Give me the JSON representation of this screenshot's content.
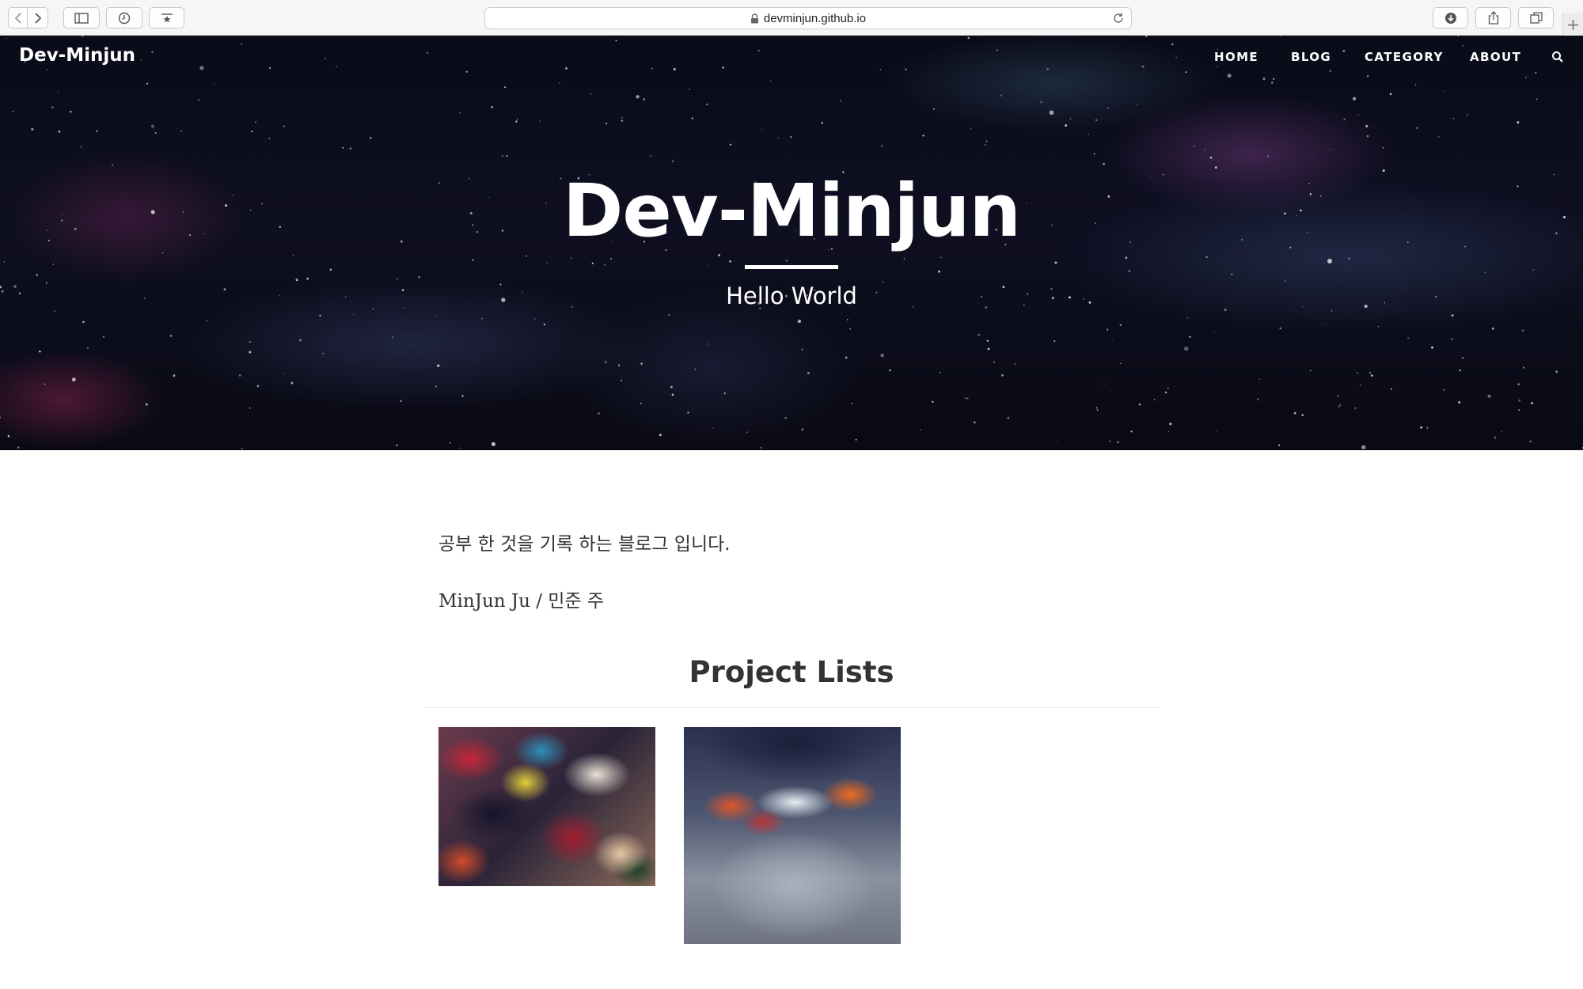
{
  "browser": {
    "url": "devminjun.github.io",
    "new_tab_label": "+"
  },
  "site": {
    "brand": "Dev-Minjun",
    "nav": [
      "HOME",
      "BLOG",
      "CATEGORY",
      "ABOUT"
    ]
  },
  "hero": {
    "title": "Dev-Minjun",
    "subtitle": "Hello World"
  },
  "main": {
    "intro": "공부 한 것을 기록 하는 블로그 입니다.",
    "author": "MinJun Ju / 민준 주",
    "projects_title": "Project Lists"
  },
  "colors": {
    "hero_background": "#0f1022",
    "text": "#333333",
    "chrome": "#f6f6f6"
  }
}
